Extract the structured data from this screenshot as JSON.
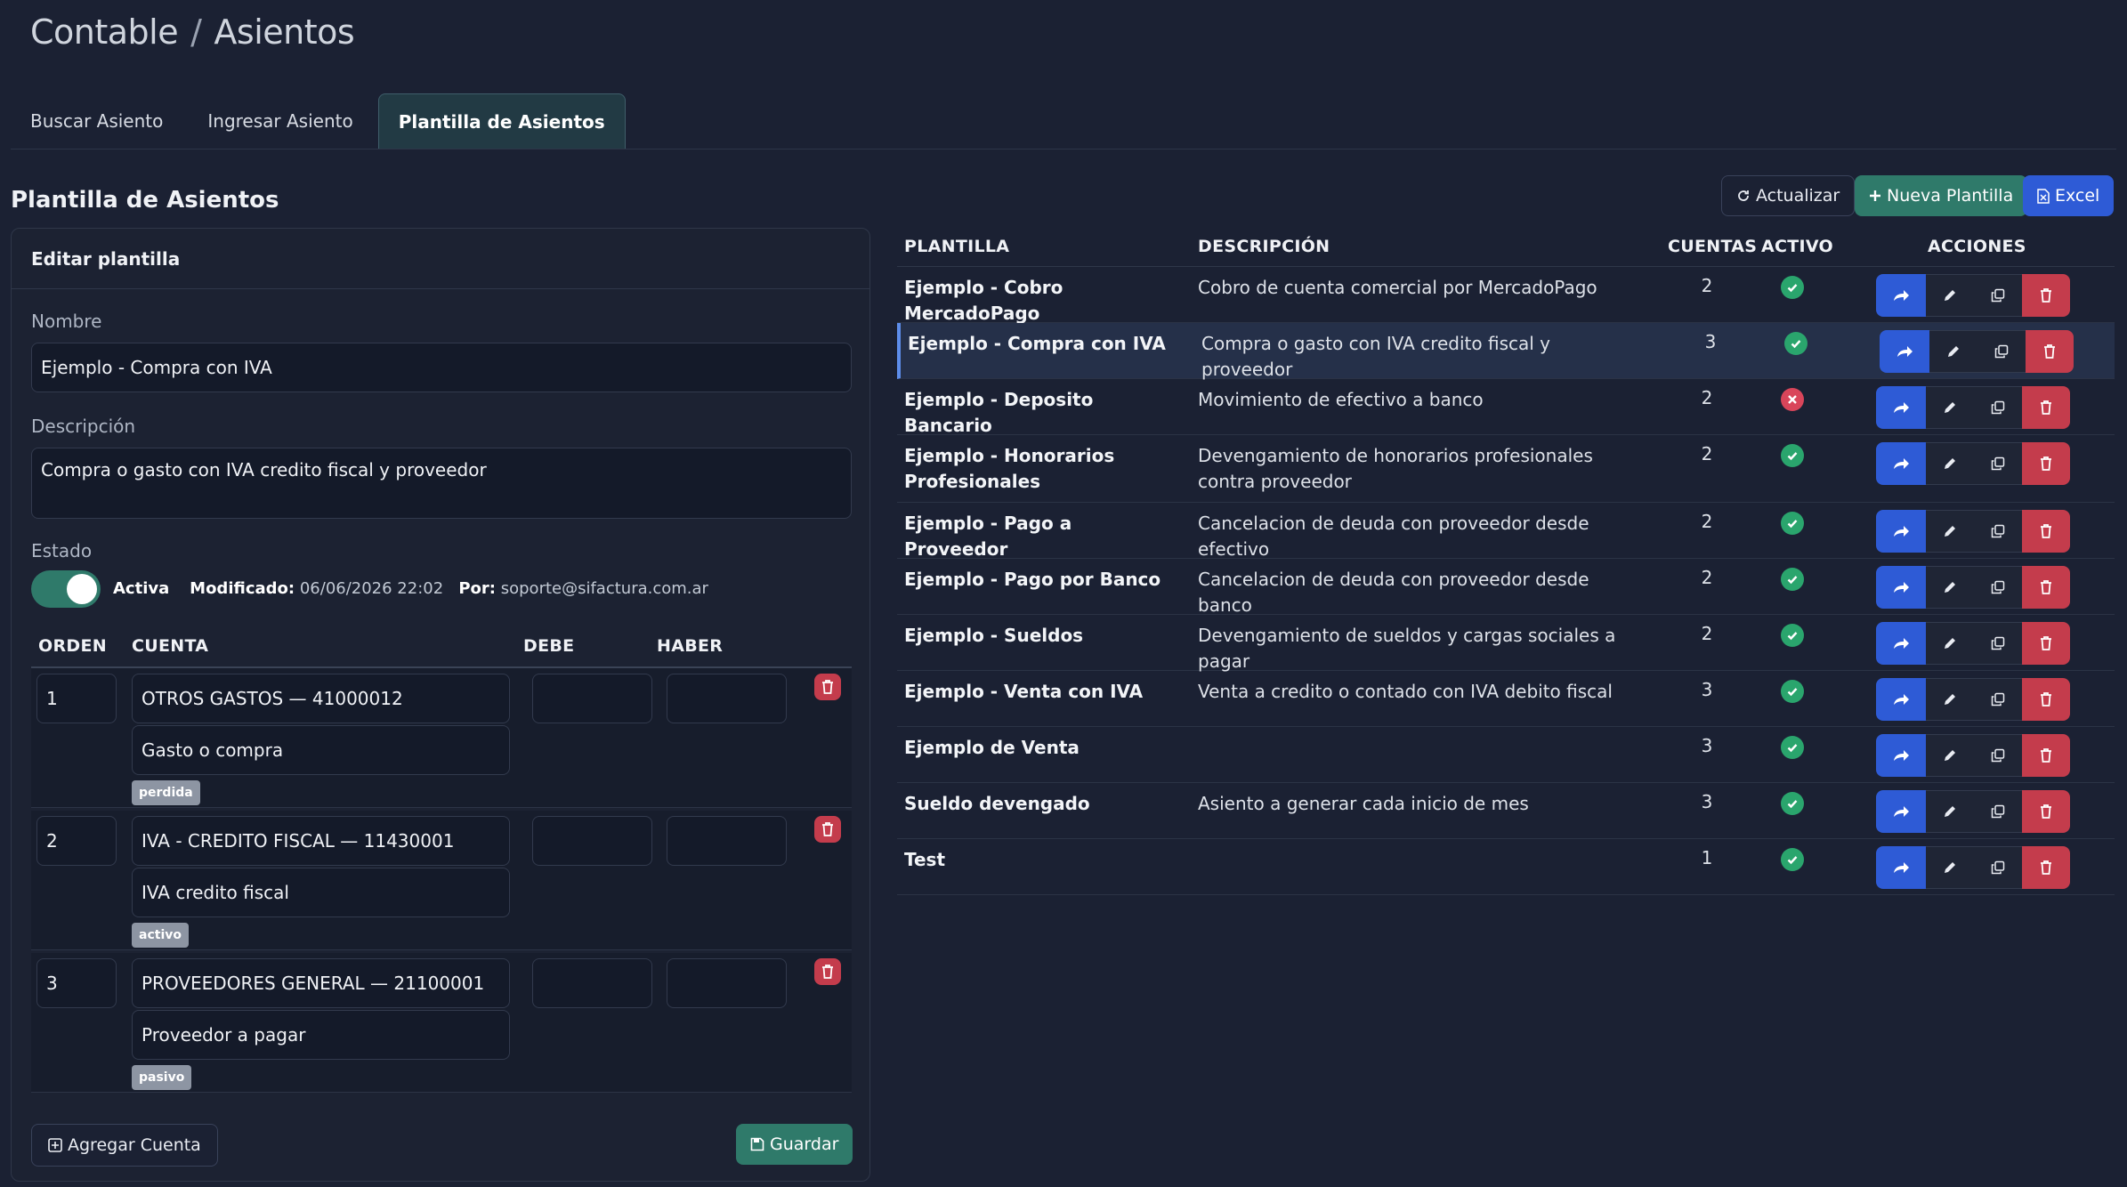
{
  "breadcrumb": {
    "root": "Contable",
    "sep": "/",
    "current": "Asientos"
  },
  "tabs": [
    {
      "label": "Buscar Asiento"
    },
    {
      "label": "Ingresar Asiento"
    },
    {
      "label": "Plantilla de Asientos",
      "active": true
    }
  ],
  "section_title": "Plantilla de Asientos",
  "editor": {
    "title": "Editar plantilla",
    "nombre_label": "Nombre",
    "nombre_value": "Ejemplo - Compra con IVA",
    "descripcion_label": "Descripción",
    "descripcion_value": "Compra o gasto con IVA credito fiscal y proveedor",
    "estado_label": "Estado",
    "estado_value": "Activa",
    "modificado_label": "Modificado:",
    "modificado_value": "06/06/2026 22:02",
    "por_label": "Por:",
    "por_value": "soporte@sifactura.com.ar",
    "columns": {
      "orden": "ORDEN",
      "cuenta": "CUENTA",
      "debe": "DEBE",
      "haber": "HABER"
    },
    "entries": [
      {
        "orden": "1",
        "cuenta": "OTROS GASTOS — 41000012",
        "detalle": "Gasto o compra",
        "tag": "perdida"
      },
      {
        "orden": "2",
        "cuenta": "IVA - CREDITO FISCAL — 11430001",
        "detalle": "IVA credito fiscal",
        "tag": "activo"
      },
      {
        "orden": "3",
        "cuenta": "PROVEEDORES GENERAL — 21100001",
        "detalle": "Proveedor a pagar",
        "tag": "pasivo"
      }
    ],
    "add_label": "Agregar Cuenta",
    "save_label": "Guardar"
  },
  "toolbar": {
    "refresh": "Actualizar",
    "new": "Nueva Plantilla",
    "excel": "Excel"
  },
  "table": {
    "headers": {
      "plantilla": "PLANTILLA",
      "descripcion": "DESCRIPCIÓN",
      "cuentas": "CUENTAS",
      "activo": "ACTIVO",
      "acciones": "ACCIONES"
    },
    "rows": [
      {
        "name": "Ejemplo - Cobro MercadoPago",
        "desc": "Cobro de cuenta comercial por MercadoPago",
        "cuentas": "2",
        "activo": true
      },
      {
        "name": "Ejemplo - Compra con IVA",
        "desc": "Compra o gasto con IVA credito fiscal y proveedor",
        "cuentas": "3",
        "activo": true,
        "selected": true
      },
      {
        "name": "Ejemplo - Deposito Bancario",
        "desc": "Movimiento de efectivo a banco",
        "cuentas": "2",
        "activo": false
      },
      {
        "name": "Ejemplo - Honorarios Profesionales",
        "desc": "Devengamiento de honorarios profesionales contra proveedor",
        "cuentas": "2",
        "activo": true,
        "tall": true
      },
      {
        "name": "Ejemplo - Pago a Proveedor",
        "desc": "Cancelacion de deuda con proveedor desde efectivo",
        "cuentas": "2",
        "activo": true
      },
      {
        "name": "Ejemplo - Pago por Banco",
        "desc": "Cancelacion de deuda con proveedor desde banco",
        "cuentas": "2",
        "activo": true
      },
      {
        "name": "Ejemplo - Sueldos",
        "desc": "Devengamiento de sueldos y cargas sociales a pagar",
        "cuentas": "2",
        "activo": true
      },
      {
        "name": "Ejemplo - Venta con IVA",
        "desc": "Venta a credito o contado con IVA debito fiscal",
        "cuentas": "3",
        "activo": true
      },
      {
        "name": "Ejemplo de Venta",
        "desc": "",
        "cuentas": "3",
        "activo": true
      },
      {
        "name": "Sueldo devengado",
        "desc": "Asiento a generar cada inicio de mes",
        "cuentas": "3",
        "activo": true
      },
      {
        "name": "Test",
        "desc": "",
        "cuentas": "1",
        "activo": true
      }
    ]
  },
  "colors": {
    "bg": "#1b2133",
    "green": "#2f7a6a",
    "blue": "#2e5bd6",
    "red": "#c43c4c",
    "ok": "#2aa56d",
    "no": "#d9455a"
  },
  "icons": {
    "refresh": "refresh-icon",
    "plus": "plus-icon",
    "excel": "excel-icon",
    "go": "share-arrow-icon",
    "edit": "pencil-icon",
    "copy": "copy-icon",
    "delete": "trash-icon",
    "save": "floppy-icon",
    "add": "plus-square-icon"
  }
}
